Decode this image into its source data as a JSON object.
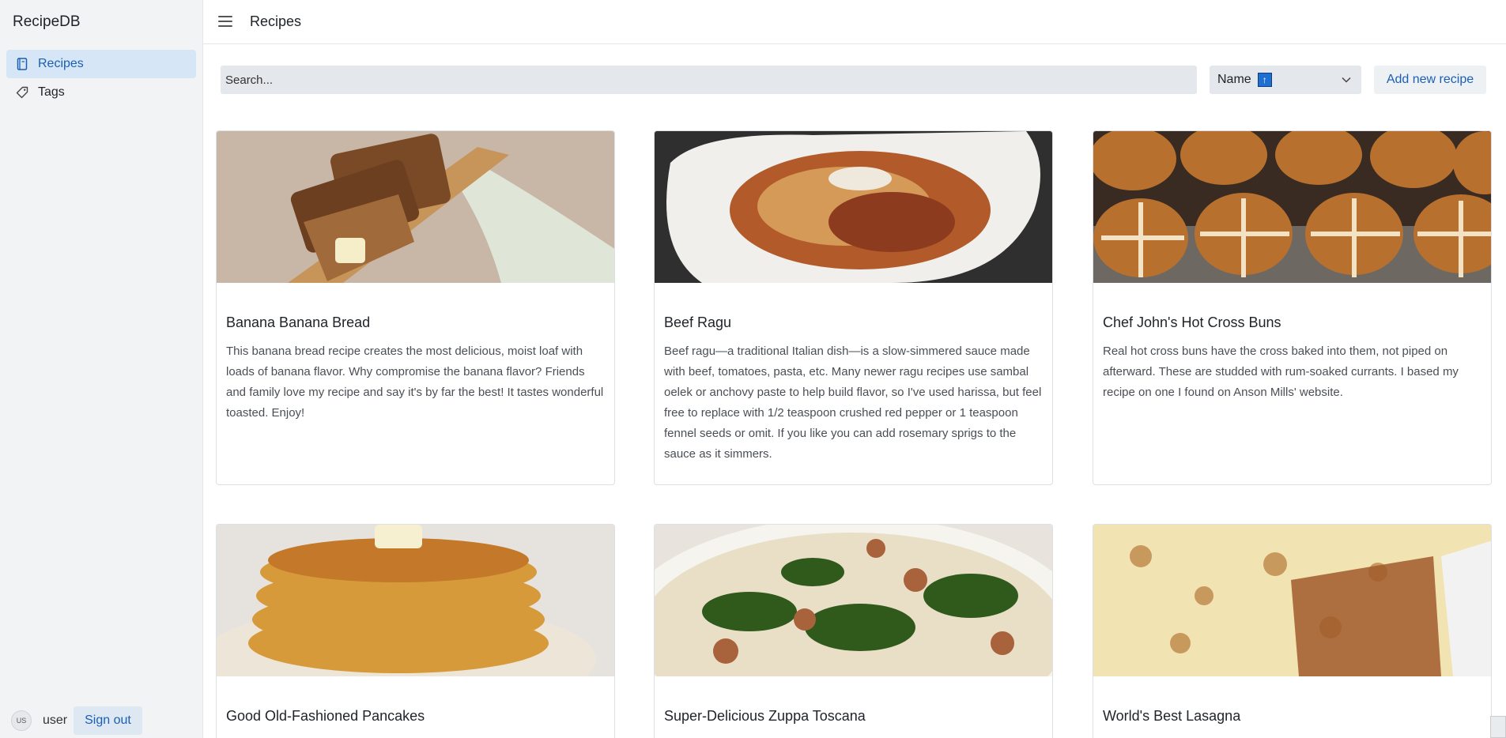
{
  "app": {
    "brand": "RecipeDB"
  },
  "sidebar": {
    "items": [
      {
        "label": "Recipes",
        "icon": "book-icon",
        "active": true
      },
      {
        "label": "Tags",
        "icon": "tag-icon",
        "active": false
      }
    ],
    "footer": {
      "avatar_initials": "US",
      "username": "user",
      "signout_label": "Sign out"
    }
  },
  "header": {
    "title": "Recipes",
    "menu_icon": "hamburger-menu-icon"
  },
  "toolbar": {
    "search_placeholder": "Search...",
    "sort": {
      "selected": "Name",
      "direction_icon": "arrow-up-icon",
      "direction_glyph": "↑"
    },
    "add_label": "Add new recipe"
  },
  "recipes": [
    {
      "title": "Banana Banana Bread",
      "description": "This banana bread recipe creates the most delicious, moist loaf with loads of banana flavor. Why compromise the banana flavor? Friends and family love my recipe and say it's by far the best! It tastes wonderful toasted. Enjoy!",
      "image": "banana-bread-photo"
    },
    {
      "title": "Beef Ragu",
      "description": "Beef ragu—a traditional Italian dish—is a slow-simmered sauce made with beef, tomatoes, pasta, etc. Many newer ragu recipes use sambal oelek or anchovy paste to help build flavor, so I've used harissa, but feel free to replace with 1/2 teaspoon crushed red pepper or 1 teaspoon fennel seeds or omit. If you like you can add rosemary sprigs to the sauce as it simmers.",
      "image": "beef-ragu-photo"
    },
    {
      "title": "Chef John's Hot Cross Buns",
      "description": "Real hot cross buns have the cross baked into them, not piped on afterward. These are studded with rum-soaked currants. I based my recipe on one I found on Anson Mills' website.",
      "image": "hot-cross-buns-photo"
    },
    {
      "title": "Good Old-Fashioned Pancakes",
      "description": "",
      "image": "pancakes-photo"
    },
    {
      "title": "Super-Delicious Zuppa Toscana",
      "description": "",
      "image": "zuppa-toscana-photo"
    },
    {
      "title": "World's Best Lasagna",
      "description": "",
      "image": "lasagna-photo"
    }
  ]
}
